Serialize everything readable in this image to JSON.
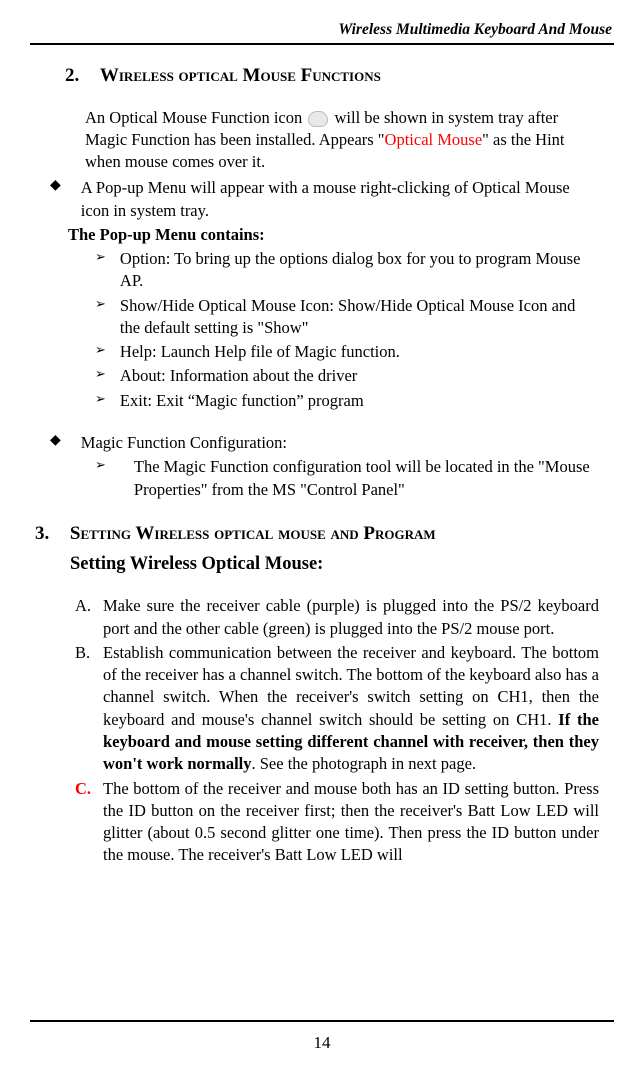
{
  "header": {
    "title": "Wireless Multimedia Keyboard And Mouse"
  },
  "section2": {
    "number": "2.",
    "title": "Wireless optical Mouse Functions",
    "intro_pre": "An Optical Mouse Function icon ",
    "intro_post": " will be shown in system tray after Magic Function has been installed. Appears \"",
    "intro_red": "Optical Mouse",
    "intro_end": "\" as the Hint when mouse comes over it.",
    "diamond1": "A Pop-up Menu will appear with a mouse right-clicking of Optical Mouse icon in system tray.",
    "popup_heading": "The Pop-up Menu contains:",
    "arrows1": [
      "Option: To bring up the options dialog box for you to program Mouse AP.",
      "Show/Hide Optical Mouse Icon: Show/Hide Optical Mouse Icon and the default setting is \"Show\"",
      "Help: Launch Help file of Magic function.",
      "About: Information about the driver",
      "Exit: Exit “Magic function” program"
    ],
    "diamond2": "Magic Function Configuration:",
    "arrows2": [
      "The Magic Function configuration tool will be located in the \"Mouse Properties\" from the MS \"Control Panel\""
    ]
  },
  "section3": {
    "number": "3.",
    "title": "Setting Wireless optical mouse and Program",
    "subtitle": "Setting Wireless Optical Mouse:",
    "items": {
      "A": {
        "label": "A.",
        "text": "Make sure the receiver cable (purple) is plugged into the PS/2 keyboard port and the other cable (green) is plugged into the PS/2 mouse port."
      },
      "B": {
        "label": "B.",
        "text_pre": "Establish communication between the receiver and keyboard. The bottom of the receiver has a channel switch. The bottom of the keyboard also has a channel switch. When the receiver's switch setting on CH1, then the keyboard and mouse's channel switch should be setting on CH1. ",
        "text_bold": "If the keyboard and mouse setting different channel with receiver, then they won't work normally",
        "text_post": ". See the photograph in next page."
      },
      "C": {
        "label": "C.",
        "text": "The bottom of the receiver and mouse both has an ID setting button. Press the ID button on the receiver first; then the receiver's Batt Low LED will glitter (about 0.5 second glitter one time). Then press the ID button under the mouse. The receiver's Batt Low LED will"
      }
    }
  },
  "footer": {
    "page_number": "14"
  },
  "bullets": {
    "diamond": "◆",
    "arrow": "➢"
  }
}
